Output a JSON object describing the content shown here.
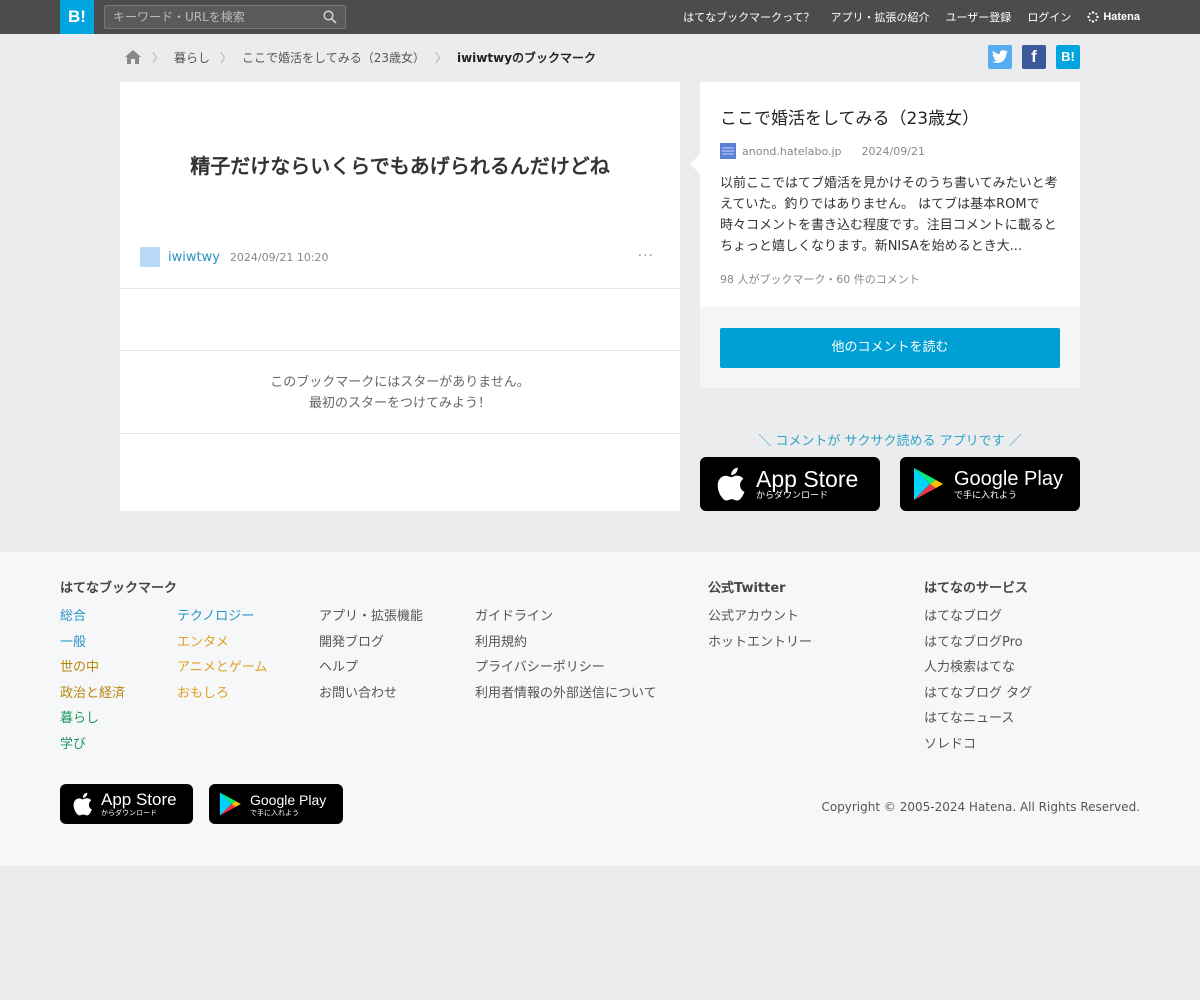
{
  "header": {
    "logo_text": "B!",
    "search_placeholder": "キーワード・URLを検索",
    "nav": [
      "はてなブックマークって？",
      "アプリ・拡張の紹介",
      "ユーザー登録",
      "ログイン"
    ],
    "brand": "Hatena"
  },
  "breadcrumb": {
    "items": [
      "暮らし",
      "ここで婚活をしてみる（23歳女）"
    ],
    "current": "iwiwtwyのブックマーク"
  },
  "share": {
    "twitter_color": "#55acee",
    "facebook_color": "#3b5998",
    "hatena_color": "#00a4de",
    "facebook_label": "f",
    "hatena_label": "B!"
  },
  "bookmark": {
    "comment": "精子だけならいくらでもあげられるんだけどね",
    "user": "iwiwtwy",
    "datetime": "2024/09/21 10:20",
    "more": "···",
    "no_star_line1": "このブックマークにはスターがありません。",
    "no_star_line2": "最初のスターをつけてみよう！"
  },
  "entry": {
    "title": "ここで婚活をしてみる（23歳女）",
    "domain": "anond.hatelabo.jp",
    "date": "2024/09/21",
    "description": "以前ここではてブ婚活を見かけそのうち書いてみたいと考えていた。釣りではありません。 はてブは基本ROMで時々コメントを書き込む程度です。注目コメントに載るとちょっと嬉しくなります。新NISAを始めるとき大...",
    "counts": "98 人がブックマーク・60 件のコメント",
    "read_button": "他のコメントを読む"
  },
  "promo": {
    "text": "＼ コメントが サクサク読める アプリです ／",
    "appstore_big": "App Store",
    "appstore_small": "からダウンロード",
    "googleplay_big": "Google Play",
    "googleplay_small": "で手に入れよう"
  },
  "footer": {
    "bookmark_heading": "はてなブックマーク",
    "categories1": [
      {
        "label": "総合",
        "color": "#2694c4"
      },
      {
        "label": "一般",
        "color": "#2694c4"
      },
      {
        "label": "世の中",
        "color": "#b8860b"
      },
      {
        "label": "政治と経済",
        "color": "#b8860b"
      },
      {
        "label": "暮らし",
        "color": "#1f9660"
      },
      {
        "label": "学び",
        "color": "#1f9660"
      }
    ],
    "categories2": [
      {
        "label": "テクノロジー",
        "color": "#2694c4"
      },
      {
        "label": "エンタメ",
        "color": "#e0a020"
      },
      {
        "label": "アニメとゲーム",
        "color": "#e0a020"
      },
      {
        "label": "おもしろ",
        "color": "#e0a020"
      }
    ],
    "links1": [
      "アプリ・拡張機能",
      "開発ブログ",
      "ヘルプ",
      "お問い合わせ"
    ],
    "links2": [
      "ガイドライン",
      "利用規約",
      "プライバシーポリシー",
      "利用者情報の外部送信について"
    ],
    "twitter_heading": "公式Twitter",
    "twitter_links": [
      "公式アカウント",
      "ホットエントリー"
    ],
    "services_heading": "はてなのサービス",
    "services": [
      "はてなブログ",
      "はてなブログPro",
      "人力検索はてな",
      "はてなブログ タグ",
      "はてなニュース",
      "ソレドコ"
    ],
    "copyright": "Copyright © 2005-2024 Hatena. All Rights Reserved."
  }
}
